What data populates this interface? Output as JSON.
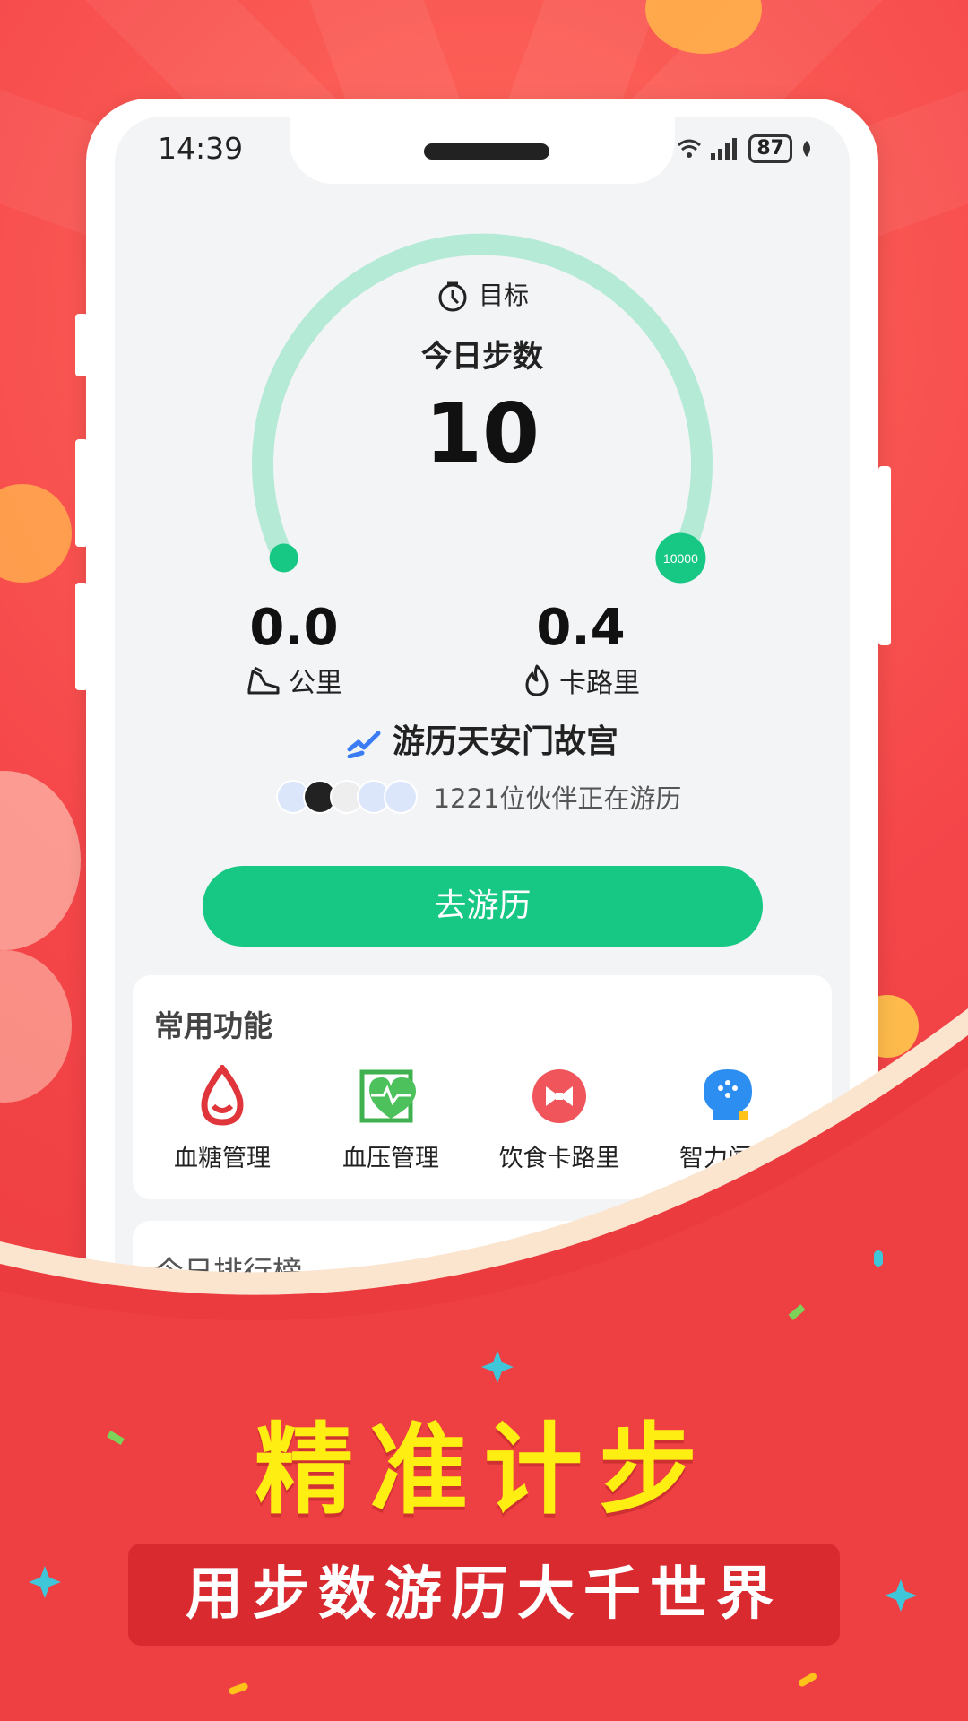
{
  "status_bar": {
    "time": "14:39",
    "battery": "87"
  },
  "gauge": {
    "goal_label": "目标",
    "steps_label": "今日步数",
    "steps_value": "10",
    "goal_value": "10000",
    "progress": 0.001
  },
  "stats": {
    "distance_value": "0.0",
    "distance_unit": "公里",
    "calories_value": "0.4",
    "calories_unit": "卡路里"
  },
  "tour": {
    "title": "游历天安门故宫",
    "partners_text": "1221位伙伴正在游历",
    "button_label": "去游历"
  },
  "functions": {
    "title": "常用功能",
    "items": [
      {
        "label": "血糖管理",
        "icon": "blood-drop-icon"
      },
      {
        "label": "血压管理",
        "icon": "heart-monitor-icon"
      },
      {
        "label": "饮食卡路里",
        "icon": "bowtie-icon"
      },
      {
        "label": "智力闯关",
        "icon": "brain-icon"
      }
    ]
  },
  "ranking": {
    "title": "今日排行榜"
  },
  "promo": {
    "headline": "精准计步",
    "subline": "用步数游历大千世界"
  },
  "colors": {
    "accent": "#17c784",
    "gauge_track": "#b4ead6",
    "bg_red": "#f5474a",
    "headline": "#ffee12"
  }
}
